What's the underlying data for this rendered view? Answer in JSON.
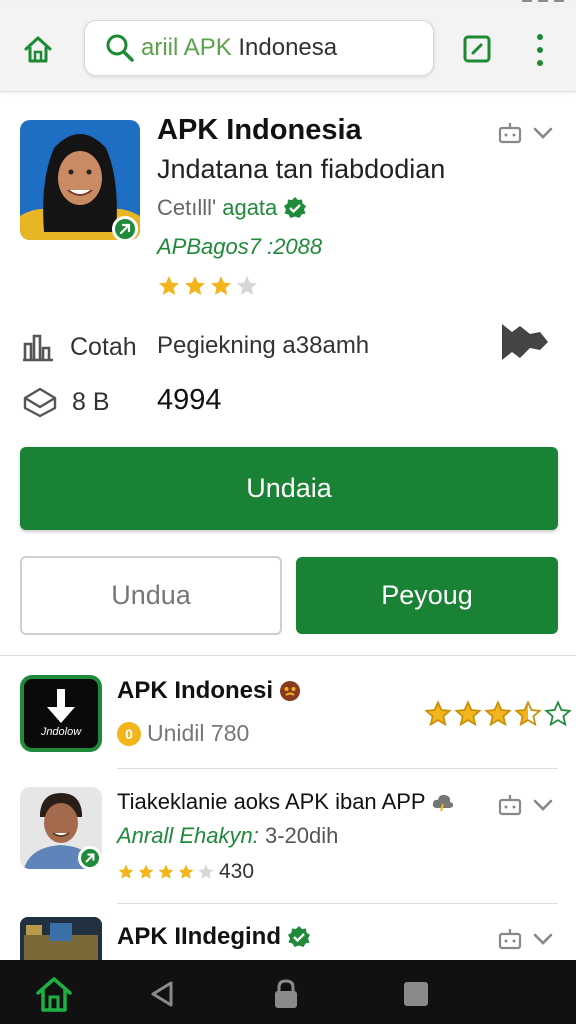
{
  "search": {
    "query_highlight": "ariil APK",
    "query_rest": " Indonesa"
  },
  "app": {
    "title": "APK Indonesia",
    "subtitle": "Jndatana tan fiabdodian",
    "developer_prefix": "Cetılll'",
    "developer_name": "agata",
    "version": "APBagos7 :2088",
    "rating": 3,
    "rating_max": 4
  },
  "info": {
    "row1_label": "Cotah",
    "row1_value": "Pegiekning a38amh",
    "row2_label": "8 B",
    "row2_value": "4994"
  },
  "buttons": {
    "primary": "Undaia",
    "secondary": "Undua",
    "tertiary": "Peyoug"
  },
  "list": [
    {
      "title": "APK Indonesi",
      "icon_label": "Jndolow",
      "meta": "Unidil 780",
      "rating": 3.5,
      "rating_max": 5
    },
    {
      "title": "Tiakeklanie aoks APK iban APP",
      "developer": "Anrall Ehakyn:",
      "developer_detail": " 3-20dih",
      "rating": 4,
      "rating_max": 5,
      "rating_count": "430"
    },
    {
      "title": "APK IIndegind"
    }
  ],
  "colors": {
    "accent": "#198234",
    "star": "#f2b51c",
    "navbar": "#111111"
  },
  "icons": [
    "home-icon",
    "search-icon",
    "edit-square-icon",
    "more-vert-icon",
    "android-icon",
    "chevron-down-icon",
    "verified-icon",
    "chart-icon",
    "package-icon",
    "share-icon",
    "coin-icon",
    "back-icon",
    "lock-icon",
    "recents-icon"
  ]
}
